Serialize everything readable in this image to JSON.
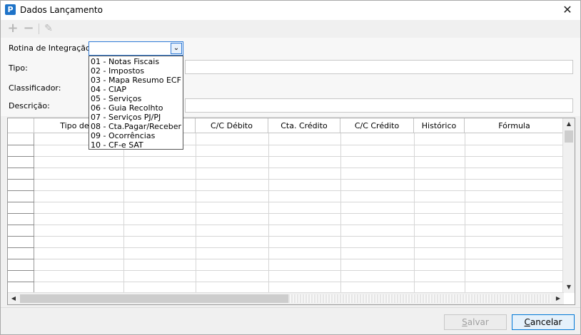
{
  "window": {
    "title": "Dados Lançamento",
    "app_icon_letter": "P"
  },
  "toolbar": {
    "add_icon": "plus-icon",
    "remove_icon": "minus-icon",
    "edit_icon": "pencil-icon"
  },
  "form": {
    "rotina_label": "Rotina de Integração:",
    "rotina_value": "",
    "tipo_label": "Tipo:",
    "tipo_value": "",
    "classificador_label": "Classificador:",
    "descricao_label": "Descrição:",
    "descricao_value": ""
  },
  "dropdown": {
    "options": [
      "01 - Notas Fiscais",
      "02 - Impostos",
      "03 - Mapa Resumo ECF",
      "04 - CIAP",
      "05 - Serviços",
      "06 - Guia Recolhto",
      "07 - Serviços PJ/PJ",
      "08 - Cta.Pagar/Receber",
      "09 - Ocorrências",
      "10 - CF-e SAT"
    ]
  },
  "grid": {
    "columns": [
      "Tipo de V",
      "",
      "C/C Débito",
      "Cta. Crédito",
      "C/C Crédito",
      "Histórico",
      "Fórmula"
    ]
  },
  "buttons": {
    "save_prefix": "S",
    "save_rest": "alvar",
    "cancel_prefix": "C",
    "cancel_rest": "ancelar"
  }
}
